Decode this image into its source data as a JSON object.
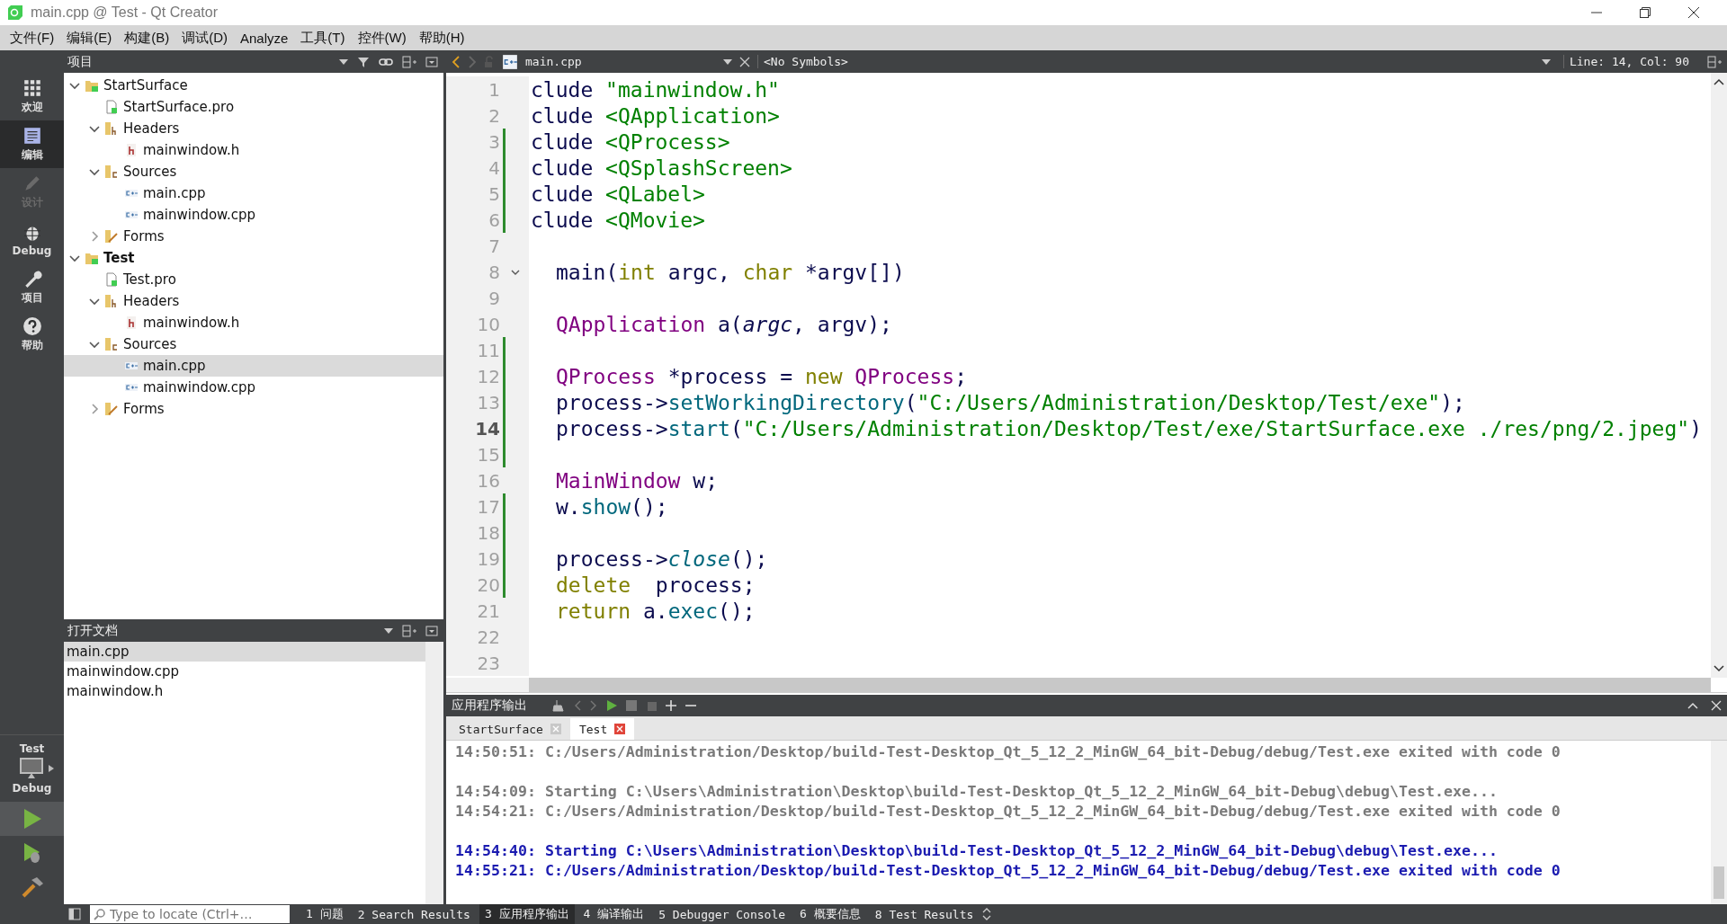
{
  "window": {
    "title": "main.cpp @ Test - Qt Creator"
  },
  "menu": [
    "文件(F)",
    "编辑(E)",
    "构建(B)",
    "调试(D)",
    "Analyze",
    "工具(T)",
    "控件(W)",
    "帮助(H)"
  ],
  "modes": [
    {
      "label": "欢迎",
      "kind": "welcome",
      "selected": false,
      "disabled": false
    },
    {
      "label": "编辑",
      "kind": "edit",
      "selected": true,
      "disabled": false
    },
    {
      "label": "设计",
      "kind": "design",
      "selected": false,
      "disabled": true
    },
    {
      "label": "Debug",
      "kind": "debug",
      "selected": false,
      "disabled": false
    },
    {
      "label": "项目",
      "kind": "projects",
      "selected": false,
      "disabled": false
    },
    {
      "label": "帮助",
      "kind": "help",
      "selected": false,
      "disabled": false
    }
  ],
  "kit": {
    "project": "Test",
    "config": "Debug"
  },
  "project_pane": {
    "title": "项目",
    "tree": [
      {
        "label": "StartSurface",
        "kind": "project",
        "bold": false,
        "expanded": true,
        "selected": false,
        "children": [
          {
            "label": "StartSurface.pro",
            "kind": "pro",
            "selected": false
          },
          {
            "label": "Headers",
            "kind": "headers",
            "expanded": true,
            "selected": false,
            "children": [
              {
                "label": "mainwindow.h",
                "kind": "h",
                "selected": false
              }
            ]
          },
          {
            "label": "Sources",
            "kind": "sources",
            "expanded": true,
            "selected": false,
            "children": [
              {
                "label": "main.cpp",
                "kind": "cpp",
                "selected": false
              },
              {
                "label": "mainwindow.cpp",
                "kind": "cpp",
                "selected": false
              }
            ]
          },
          {
            "label": "Forms",
            "kind": "forms",
            "expanded": false,
            "selected": false
          }
        ]
      },
      {
        "label": "Test",
        "kind": "project",
        "bold": true,
        "expanded": true,
        "selected": false,
        "children": [
          {
            "label": "Test.pro",
            "kind": "pro",
            "selected": false
          },
          {
            "label": "Headers",
            "kind": "headers",
            "expanded": true,
            "selected": false,
            "children": [
              {
                "label": "mainwindow.h",
                "kind": "h",
                "selected": false
              }
            ]
          },
          {
            "label": "Sources",
            "kind": "sources",
            "expanded": true,
            "selected": false,
            "children": [
              {
                "label": "main.cpp",
                "kind": "cpp",
                "selected": true
              },
              {
                "label": "mainwindow.cpp",
                "kind": "cpp",
                "selected": false
              }
            ]
          },
          {
            "label": "Forms",
            "kind": "forms",
            "expanded": false,
            "selected": false
          }
        ]
      }
    ]
  },
  "open_documents": {
    "title": "打开文档",
    "items": [
      {
        "label": "main.cpp",
        "selected": true
      },
      {
        "label": "mainwindow.cpp",
        "selected": false
      },
      {
        "label": "mainwindow.h",
        "selected": false
      }
    ]
  },
  "editor": {
    "file": "main.cpp",
    "symbols": "<No Symbols>",
    "position": "Line: 14, Col: 90",
    "lines": [
      {
        "number": "1",
        "changed": false,
        "current": false,
        "foldable": false,
        "tokens": [
          {
            "kind": "plain",
            "text": "clude "
          },
          {
            "kind": "string",
            "text": "\"mainwindow.h\""
          }
        ]
      },
      {
        "number": "2",
        "changed": false,
        "current": false,
        "foldable": false,
        "tokens": [
          {
            "kind": "plain",
            "text": "clude "
          },
          {
            "kind": "string",
            "text": "<QApplication>"
          }
        ]
      },
      {
        "number": "3",
        "changed": true,
        "current": false,
        "foldable": false,
        "tokens": [
          {
            "kind": "plain",
            "text": "clude "
          },
          {
            "kind": "string",
            "text": "<QProcess>"
          }
        ]
      },
      {
        "number": "4",
        "changed": true,
        "current": false,
        "foldable": false,
        "tokens": [
          {
            "kind": "plain",
            "text": "clude "
          },
          {
            "kind": "string",
            "text": "<QSplashScreen>"
          }
        ]
      },
      {
        "number": "5",
        "changed": true,
        "current": false,
        "foldable": false,
        "tokens": [
          {
            "kind": "plain",
            "text": "clude "
          },
          {
            "kind": "string",
            "text": "<QLabel>"
          }
        ]
      },
      {
        "number": "6",
        "changed": true,
        "current": false,
        "foldable": false,
        "tokens": [
          {
            "kind": "plain",
            "text": "clude "
          },
          {
            "kind": "string",
            "text": "<QMovie>"
          }
        ]
      },
      {
        "number": "7",
        "changed": false,
        "current": false,
        "foldable": false
      },
      {
        "number": "8",
        "changed": false,
        "current": false,
        "foldable": true,
        "indented": true,
        "tokens": [
          {
            "kind": "plain",
            "text": "main("
          },
          {
            "kind": "keyword",
            "text": "int"
          },
          {
            "kind": "plain",
            "text": " argc, "
          },
          {
            "kind": "keyword",
            "text": "char"
          },
          {
            "kind": "plain",
            "text": " *argv[])"
          }
        ]
      },
      {
        "number": "9",
        "changed": false,
        "current": false,
        "foldable": false
      },
      {
        "number": "10",
        "changed": false,
        "current": false,
        "foldable": false,
        "indented": true,
        "tokens": [
          {
            "kind": "type",
            "text": "QApplication"
          },
          {
            "kind": "plain",
            "text": " a("
          },
          {
            "kind": "param",
            "text": "argc"
          },
          {
            "kind": "plain",
            "text": ", argv);"
          }
        ]
      },
      {
        "number": "11",
        "changed": true,
        "current": false,
        "foldable": false
      },
      {
        "number": "12",
        "changed": true,
        "current": false,
        "foldable": false,
        "indented": true,
        "tokens": [
          {
            "kind": "type",
            "text": "QProcess"
          },
          {
            "kind": "plain",
            "text": " *process = "
          },
          {
            "kind": "keyword",
            "text": "new"
          },
          {
            "kind": "type",
            "text": " QProcess"
          },
          {
            "kind": "plain",
            "text": ";"
          }
        ]
      },
      {
        "number": "13",
        "changed": true,
        "current": false,
        "foldable": false,
        "indented": true,
        "tokens": [
          {
            "kind": "plain",
            "text": "process->"
          },
          {
            "kind": "member",
            "text": "setWorkingDirectory"
          },
          {
            "kind": "plain",
            "text": "("
          },
          {
            "kind": "string",
            "text": "\"C:/Users/Administration/Desktop/Test/exe\""
          },
          {
            "kind": "plain",
            "text": ");"
          }
        ]
      },
      {
        "number": "14",
        "changed": true,
        "current": true,
        "foldable": false,
        "indented": true,
        "tokens": [
          {
            "kind": "plain",
            "text": "process->"
          },
          {
            "kind": "member",
            "text": "start"
          },
          {
            "kind": "plain",
            "text": "("
          },
          {
            "kind": "string",
            "text": "\"C:/Users/Administration/Desktop/Test/exe/StartSurface.exe ./res/png/2.jpeg\""
          },
          {
            "kind": "plain",
            "text": ")"
          }
        ]
      },
      {
        "number": "15",
        "changed": true,
        "current": false,
        "foldable": false
      },
      {
        "number": "16",
        "changed": false,
        "current": false,
        "foldable": false,
        "indented": true,
        "tokens": [
          {
            "kind": "type",
            "text": "MainWindow"
          },
          {
            "kind": "plain",
            "text": " w;"
          }
        ]
      },
      {
        "number": "17",
        "changed": true,
        "current": false,
        "foldable": false,
        "indented": true,
        "tokens": [
          {
            "kind": "plain",
            "text": "w."
          },
          {
            "kind": "member",
            "text": "show"
          },
          {
            "kind": "plain",
            "text": "();"
          }
        ]
      },
      {
        "number": "18",
        "changed": true,
        "current": false,
        "foldable": false
      },
      {
        "number": "19",
        "changed": true,
        "current": false,
        "foldable": false,
        "indented": true,
        "tokens": [
          {
            "kind": "plain",
            "text": "process->"
          },
          {
            "kind": "member-italic",
            "text": "close"
          },
          {
            "kind": "plain",
            "text": "();"
          }
        ]
      },
      {
        "number": "20",
        "changed": true,
        "current": false,
        "foldable": false,
        "indented": true,
        "tokens": [
          {
            "kind": "keyword",
            "text": "delete"
          },
          {
            "kind": "plain",
            "text": "  process;"
          }
        ]
      },
      {
        "number": "21",
        "changed": false,
        "current": false,
        "foldable": false,
        "indented": true,
        "tokens": [
          {
            "kind": "keyword",
            "text": "return"
          },
          {
            "kind": "plain",
            "text": " a."
          },
          {
            "kind": "member",
            "text": "exec"
          },
          {
            "kind": "plain",
            "text": "();"
          }
        ]
      },
      {
        "number": "22",
        "changed": false,
        "current": false,
        "foldable": false
      },
      {
        "number": "23",
        "changed": false,
        "current": false,
        "foldable": false
      }
    ]
  },
  "output_pane": {
    "title": "应用程序输出",
    "tabs": [
      {
        "label": "StartSurface",
        "selected": false
      },
      {
        "label": "Test",
        "selected": true
      }
    ],
    "lines": [
      {
        "kind": "old",
        "spaced": false,
        "text": "14:50:51: C:/Users/Administration/Desktop/build-Test-Desktop_Qt_5_12_2_MinGW_64_bit-Debug/debug/Test.exe exited with code 0"
      },
      {
        "kind": "old",
        "spaced": true,
        "text": "14:54:09: Starting C:\\Users\\Administration\\Desktop\\build-Test-Desktop_Qt_5_12_2_MinGW_64_bit-Debug\\debug\\Test.exe..."
      },
      {
        "kind": "old",
        "spaced": false,
        "text": "14:54:21: C:/Users/Administration/Desktop/build-Test-Desktop_Qt_5_12_2_MinGW_64_bit-Debug/debug/Test.exe exited with code 0"
      },
      {
        "kind": "new",
        "spaced": true,
        "text": "14:54:40: Starting C:\\Users\\Administration\\Desktop\\build-Test-Desktop_Qt_5_12_2_MinGW_64_bit-Debug\\debug\\Test.exe..."
      },
      {
        "kind": "new",
        "spaced": false,
        "text": "14:55:21: C:/Users/Administration/Desktop/build-Test-Desktop_Qt_5_12_2_MinGW_64_bit-Debug/debug/Test.exe exited with code 0"
      }
    ]
  },
  "status_bar": {
    "locator": {
      "placeholder": "Type to locate (Ctrl+…"
    },
    "panes": [
      {
        "label": "1 问题",
        "selected": false
      },
      {
        "label": "2 Search Results",
        "selected": false
      },
      {
        "label": "3 应用程序输出",
        "selected": true
      },
      {
        "label": "4 编译输出",
        "selected": false
      },
      {
        "label": "5 Debugger Console",
        "selected": false
      },
      {
        "label": "6 概要信息",
        "selected": false
      },
      {
        "label": "8 Test Results",
        "selected": false
      }
    ]
  }
}
